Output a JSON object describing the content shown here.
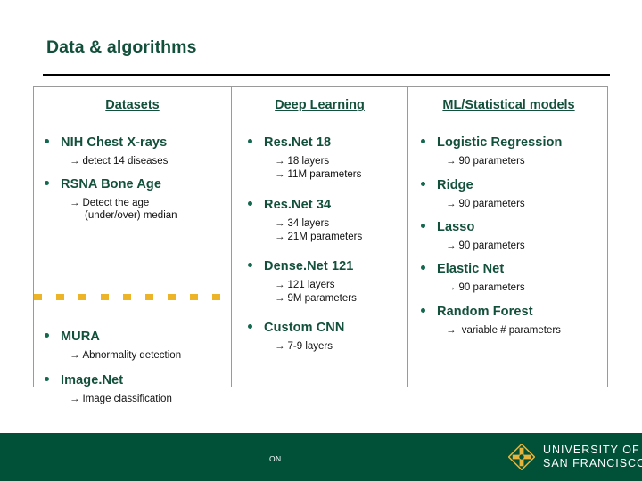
{
  "slide": {
    "title": "Data & algorithms",
    "colors": {
      "brand_green": "#13503b",
      "footer_green": "#015139",
      "gold": "#edb428",
      "rule_black": "#000000",
      "table_border": "#9a9a9a"
    }
  },
  "table": {
    "headers": [
      "Datasets",
      "Deep Learning",
      "ML/Statistical models"
    ],
    "columns": [
      {
        "name": "Datasets",
        "entries": [
          {
            "label": "NIH Chest X-rays",
            "details": [
              "detect 14 diseases"
            ]
          },
          {
            "label": "RSNA Bone Age",
            "details": [
              "Detect the age"
            ],
            "detail_cont": "(under/over) median"
          },
          {
            "label": "MURA",
            "details": [
              "Abnormality detection"
            ]
          },
          {
            "label": "Image.Net",
            "details": [
              "Image classification"
            ]
          }
        ]
      },
      {
        "name": "Deep Learning",
        "entries": [
          {
            "label": "Res.Net 18",
            "details": [
              "18 layers",
              "11M parameters"
            ]
          },
          {
            "label": "Res.Net 34",
            "details": [
              "34 layers",
              "21M parameters"
            ]
          },
          {
            "label": "Dense.Net 121",
            "details": [
              "121 layers",
              "9M parameters"
            ]
          },
          {
            "label": "Custom CNN",
            "details": [
              "7-9 layers"
            ]
          }
        ]
      },
      {
        "name": "ML/Statistical models",
        "entries": [
          {
            "label": "Logistic Regression",
            "details": [
              "90 parameters"
            ]
          },
          {
            "label": "Ridge",
            "details": [
              "90 parameters"
            ]
          },
          {
            "label": "Lasso",
            "details": [
              "90 parameters"
            ]
          },
          {
            "label": "Elastic Net",
            "details": [
              "90 parameters"
            ]
          },
          {
            "label": "Random Forest",
            "details": [
              " variable # parameters"
            ]
          }
        ]
      }
    ]
  },
  "footer": {
    "left_label": "ON",
    "logo": {
      "line1": "UNIVERSITY OF",
      "line2": "SAN FRANCISCO"
    }
  },
  "glyphs": {
    "arrow": "→"
  }
}
